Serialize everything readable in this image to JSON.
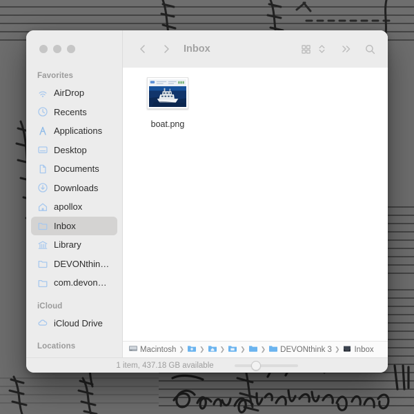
{
  "window": {
    "title": "Inbox",
    "traffic_lights": [
      "close-button",
      "minimize-button",
      "zoom-button"
    ]
  },
  "toolbar": {
    "back_label": "‹",
    "forward_label": "›",
    "title": "Inbox",
    "view_button": "icon-view-button",
    "arrange_button": "arrange-stepper",
    "more_label": "»",
    "search_label": "search-icon"
  },
  "sidebar": {
    "sections": [
      {
        "header": "Favorites",
        "items": [
          {
            "label": "AirDrop",
            "icon": "airdrop-icon",
            "selected": false
          },
          {
            "label": "Recents",
            "icon": "clock-icon",
            "selected": false
          },
          {
            "label": "Applications",
            "icon": "applications-icon",
            "selected": false
          },
          {
            "label": "Desktop",
            "icon": "desktop-icon",
            "selected": false
          },
          {
            "label": "Documents",
            "icon": "document-icon",
            "selected": false
          },
          {
            "label": "Downloads",
            "icon": "downloads-icon",
            "selected": false
          },
          {
            "label": "apollox",
            "icon": "home-icon",
            "selected": false
          },
          {
            "label": "Inbox",
            "icon": "folder-icon",
            "selected": true
          },
          {
            "label": "Library",
            "icon": "library-icon",
            "selected": false
          },
          {
            "label": "DEVONthin…",
            "icon": "folder-icon",
            "selected": false
          },
          {
            "label": "com.devon…",
            "icon": "folder-icon",
            "selected": false
          }
        ]
      },
      {
        "header": "iCloud",
        "items": [
          {
            "label": "iCloud Drive",
            "icon": "cloud-icon",
            "selected": false
          }
        ]
      },
      {
        "header": "Locations",
        "items": []
      }
    ]
  },
  "content": {
    "files": [
      {
        "name": "boat.png",
        "icon": "image-thumbnail"
      }
    ]
  },
  "pathbar": {
    "components": [
      {
        "label": "Macintosh",
        "icon": "hard-drive-icon"
      },
      {
        "label": "",
        "icon": "folder-icon-users"
      },
      {
        "label": "",
        "icon": "folder-icon-home"
      },
      {
        "label": "",
        "icon": "folder-icon-library"
      },
      {
        "label": "",
        "icon": "folder-icon-plain"
      },
      {
        "label": "DEVONthink 3",
        "icon": "folder-icon-plain"
      },
      {
        "label": "Inbox",
        "icon": "inbox-tray-icon"
      }
    ],
    "separator": "›"
  },
  "statusbar": {
    "text": "1 item, 437.18 GB available",
    "slider_name": "icon-size-slider"
  },
  "colors": {
    "sidebar_bg": "#ececec",
    "toolbar_bg": "#ececec",
    "content_bg": "#ffffff",
    "icon_blue": "#a7c8ee",
    "selection": "#d4d3d2",
    "desktop": "#6e6e6e"
  }
}
